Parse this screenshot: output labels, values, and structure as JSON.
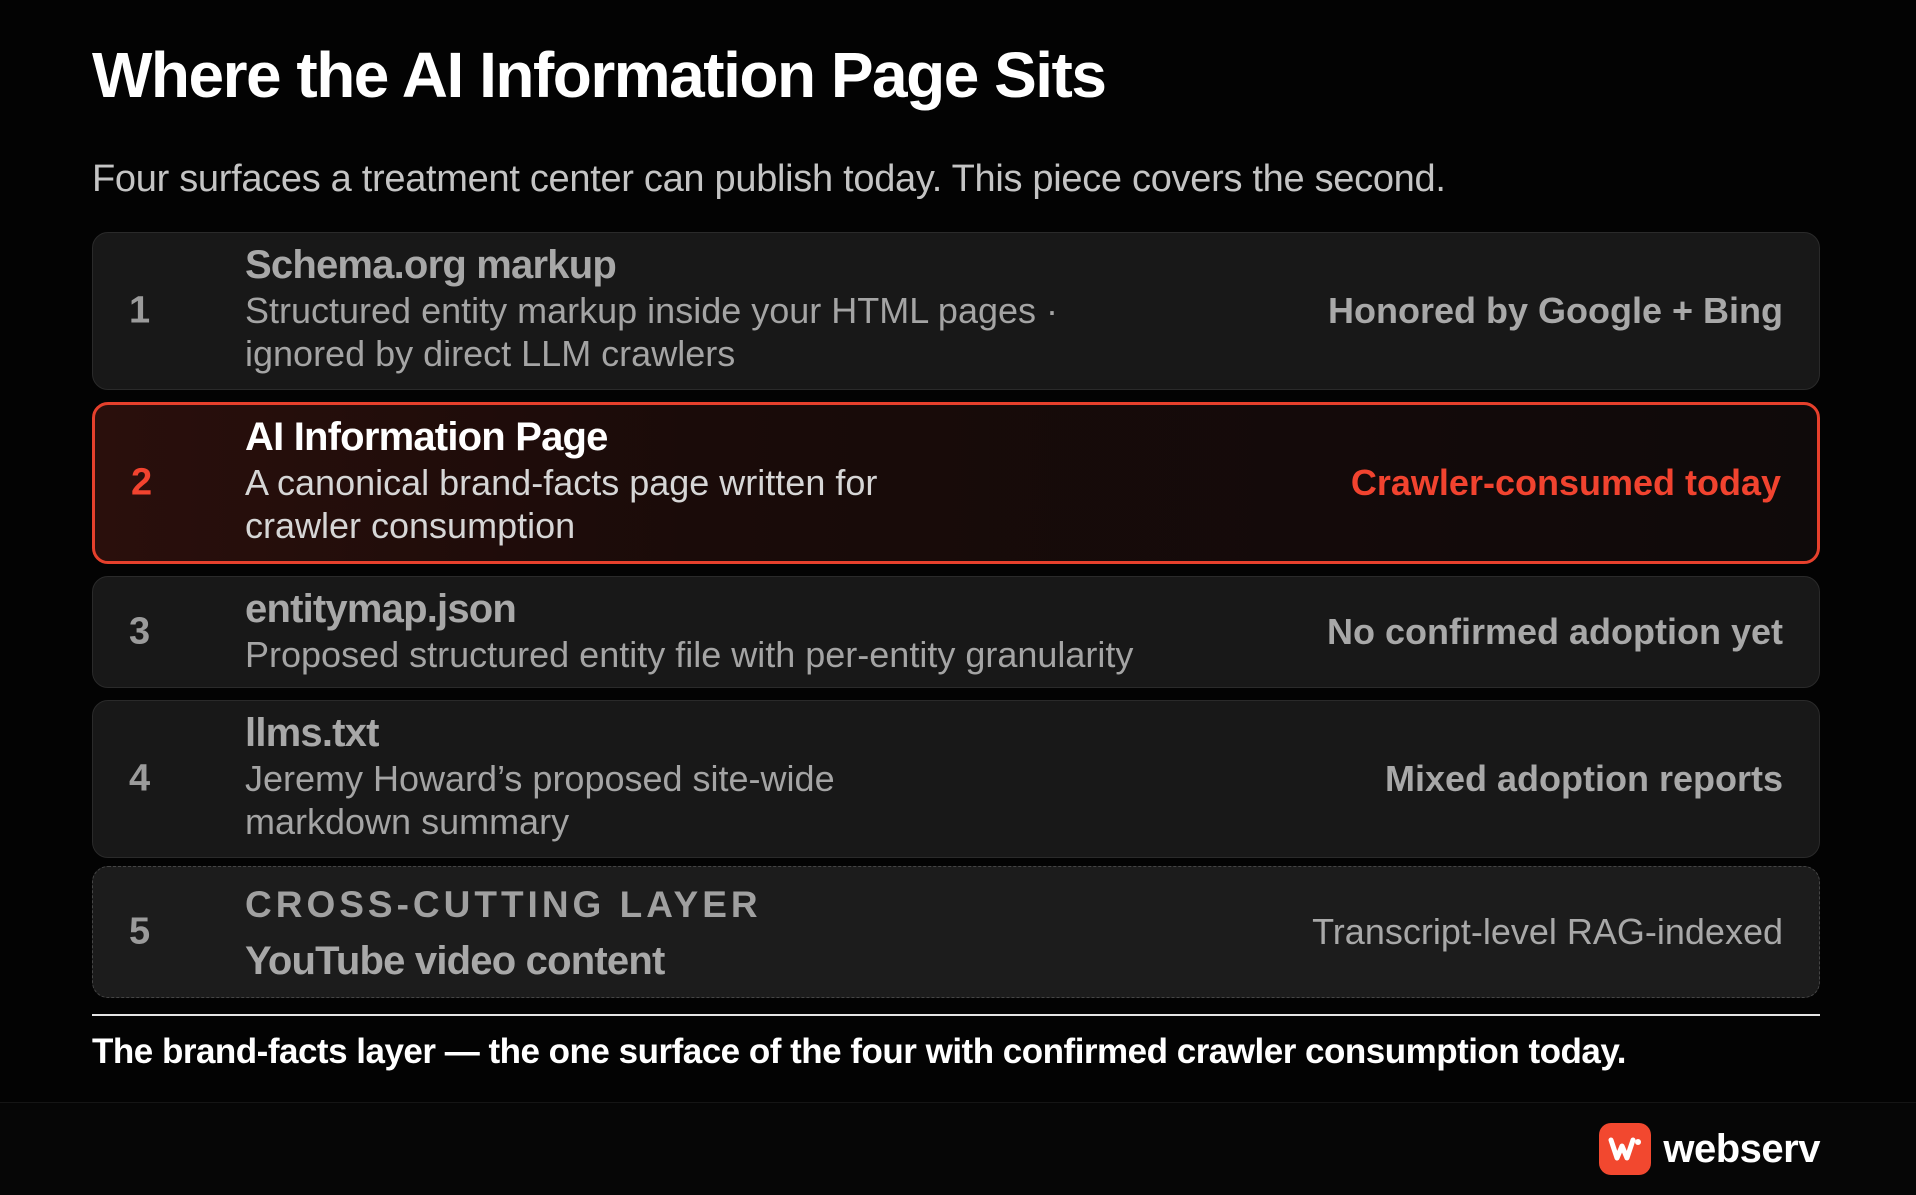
{
  "title": "Where the AI Information Page Sits",
  "subtitle": "Four surfaces a treatment center can publish today. This piece covers the second.",
  "rows": [
    {
      "number": "1",
      "name": "Schema.org markup",
      "desc_line1": "Structured entity markup inside your HTML pages ·",
      "desc_line2": "ignored by direct LLM crawlers",
      "status": "Honored by Google + Bing"
    },
    {
      "number": "2",
      "name": "AI Information Page",
      "desc_line1": "A canonical brand-facts page written for",
      "desc_line2": "crawler consumption",
      "status": "Crawler-consumed today"
    },
    {
      "number": "3",
      "name": "entitymap.json",
      "desc_line1": "Proposed structured entity file with per-entity granularity",
      "status": "No confirmed adoption yet"
    },
    {
      "number": "4",
      "name": "llms.txt",
      "desc_line1": "Jeremy Howard’s proposed site-wide",
      "desc_line2": "markdown summary",
      "status": "Mixed adoption reports"
    },
    {
      "number": "5",
      "layer": "CROSS-CUTTING LAYER",
      "name": "YouTube video content",
      "status": "Transcript-level RAG-indexed"
    }
  ],
  "caption": "The brand-facts layer — the one surface of the four with confirmed crawler consumption today.",
  "brand": {
    "name": "webserv",
    "icon": "webserv-logo-icon",
    "accent": "#f2482f"
  },
  "colors": {
    "highlight": "#e6402c",
    "background": "#030303",
    "row_background": "#181818"
  }
}
